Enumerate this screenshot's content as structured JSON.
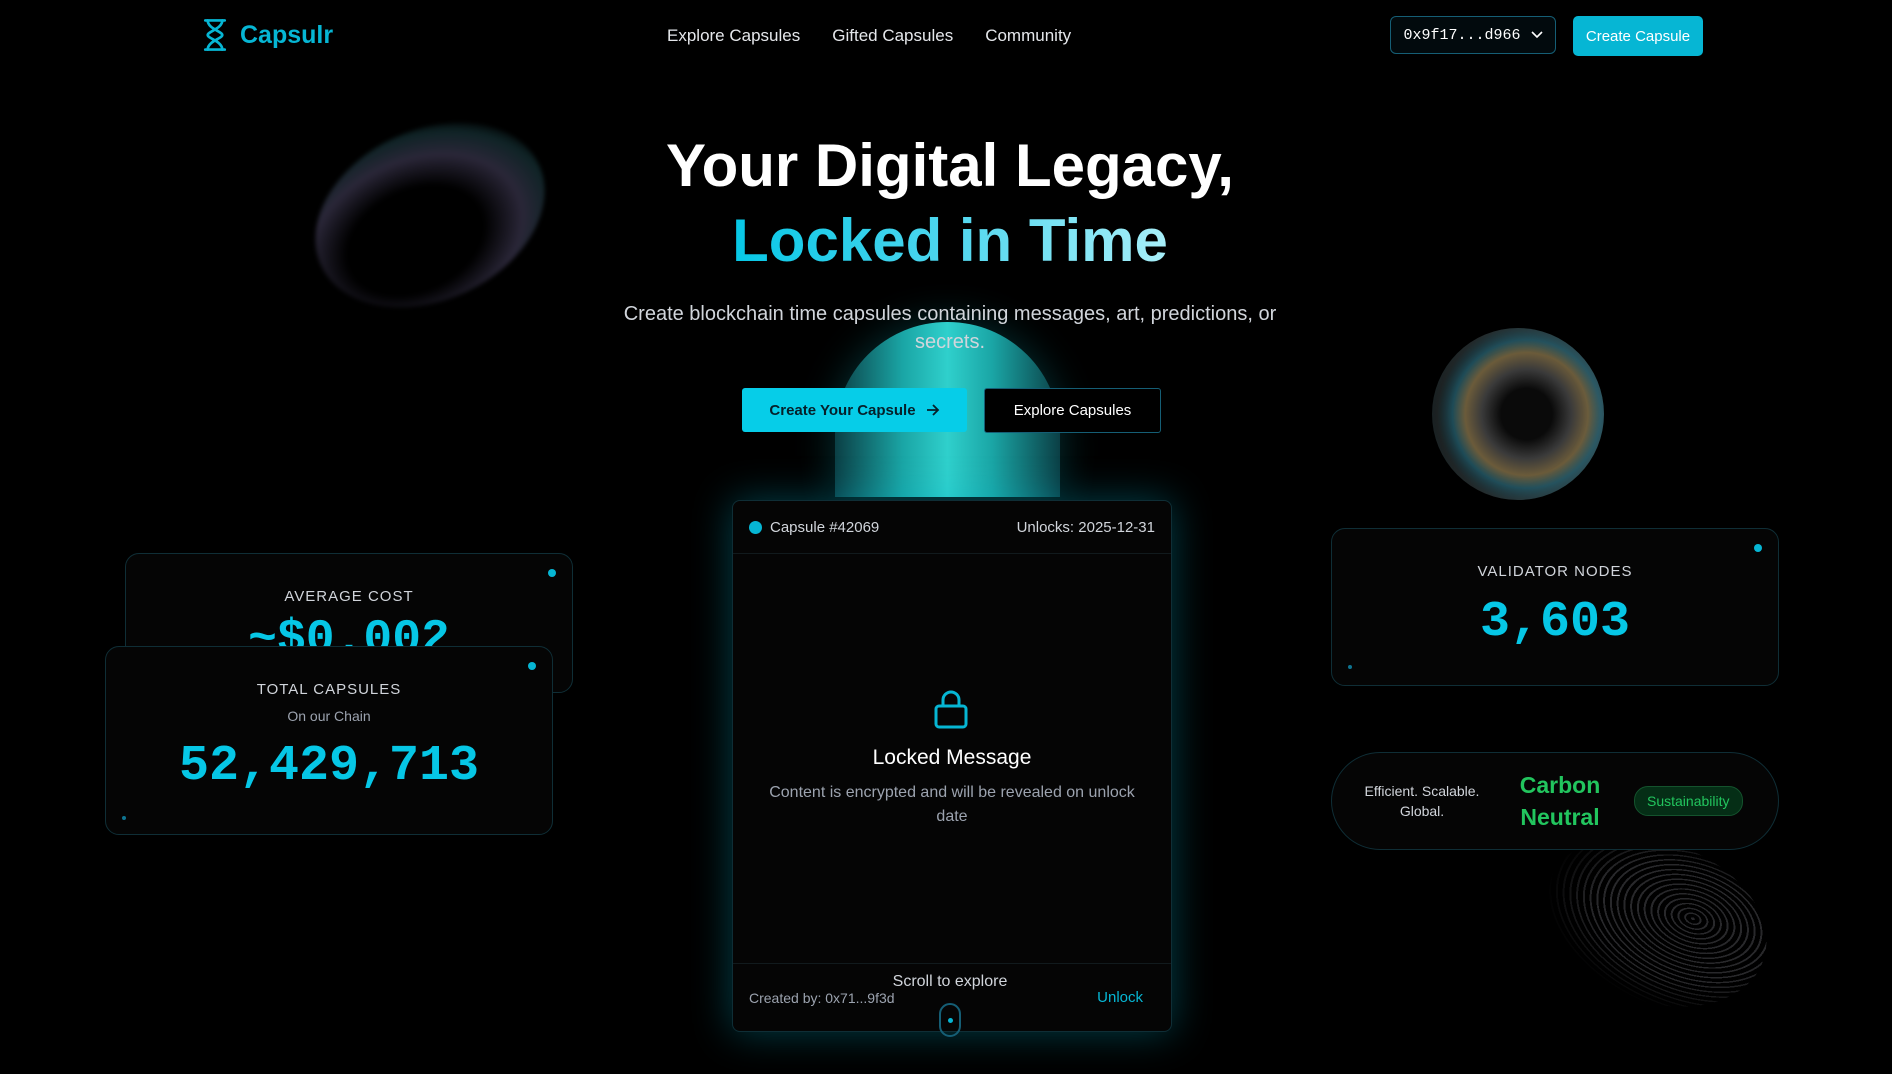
{
  "brand": {
    "name": "Capsulr",
    "accent": "#06b6d4"
  },
  "nav": {
    "items": [
      "Explore Capsules",
      "Gifted Capsules",
      "Community"
    ]
  },
  "wallet": {
    "address": "0x9f17...d966"
  },
  "header": {
    "create_label": "Create Capsule"
  },
  "hero": {
    "title_line1": "Your Digital Legacy,",
    "title_line2": "Locked in Time",
    "subtitle": "Create blockchain time capsules containing messages, art, predictions, or secrets.",
    "primary_cta": "Create Your Capsule",
    "secondary_cta": "Explore Capsules"
  },
  "capsule": {
    "id": "Capsule #42069",
    "unlocks": "Unlocks: 2025-12-31",
    "title": "Locked Message",
    "description": "Content is encrypted and will be revealed on unlock date",
    "created_by": "Created by: 0x71...9f3d",
    "unlock_label": "Unlock"
  },
  "scroll": {
    "label": "Scroll to explore"
  },
  "stats": {
    "avg_cost": {
      "label": "AVERAGE COST",
      "value": "~$0.002"
    },
    "total_capsules": {
      "label": "TOTAL CAPSULES",
      "sub": "On our Chain",
      "value": "52,429,713"
    },
    "validator_nodes": {
      "label": "VALIDATOR NODES",
      "value": "3,603"
    }
  },
  "sustainability": {
    "tagline": "Efficient. Scalable. Global.",
    "headline": "Carbon Neutral",
    "badge": "Sustainability",
    "color": "#22c55e"
  }
}
